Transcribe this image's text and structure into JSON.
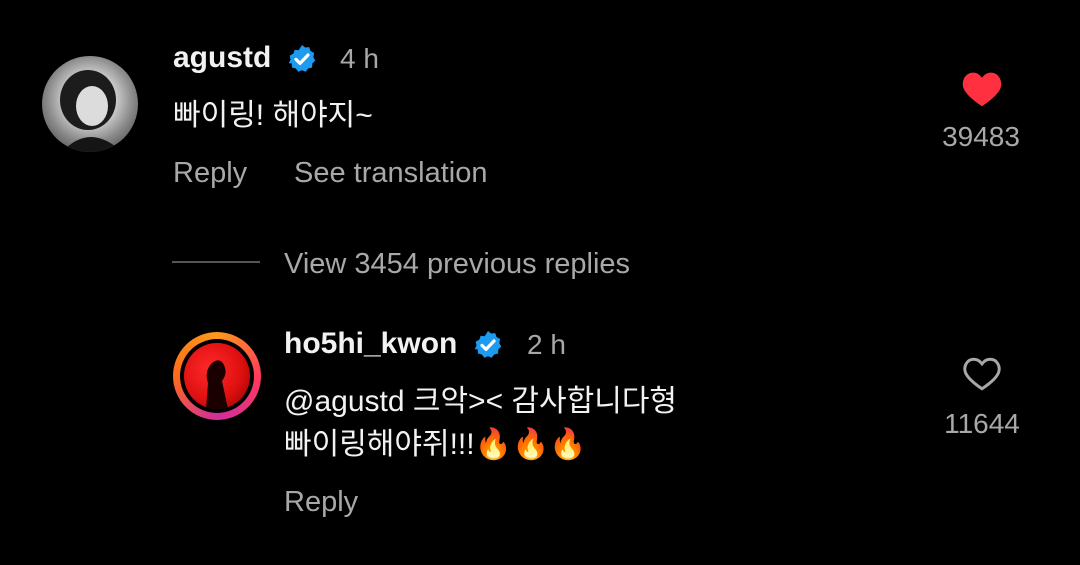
{
  "comments": [
    {
      "username": "agustd",
      "time": "4 h",
      "text": "빠이링! 해야지~",
      "reply_label": "Reply",
      "translate_label": "See translation",
      "like_count": "39483",
      "liked": true,
      "avatar_icon": "profile-photo-grayscale"
    },
    {
      "username": "ho5hi_kwon",
      "time": "2 h",
      "text_line1": "@agustd 크악>< 감사합니다형",
      "text_line2": "빠이링해야쥐!!!🔥🔥🔥",
      "reply_label": "Reply",
      "like_count": "11644",
      "liked": false,
      "avatar_icon": "profile-photo-red-silhouette"
    }
  ],
  "view_replies": "View 3454 previous replies",
  "colors": {
    "background": "#000000",
    "verified": "#1d9bf0",
    "heart_liked": "#ff3040",
    "secondary_text": "#a8a8a8"
  }
}
